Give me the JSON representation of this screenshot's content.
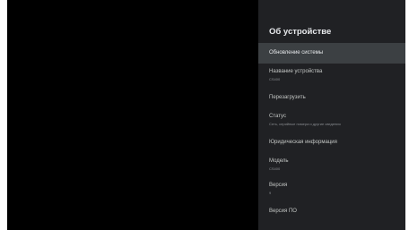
{
  "settings_panel": {
    "title": "Об устройстве",
    "items": [
      {
        "label": "Обновление системы",
        "subtitle": ""
      },
      {
        "label": "Название устройства",
        "subtitle": "CS400"
      },
      {
        "label": "Перезагрузить",
        "subtitle": ""
      },
      {
        "label": "Статус",
        "subtitle": "Сеть, серийные номера и другие сведения"
      },
      {
        "label": "Юридическая информация",
        "subtitle": ""
      },
      {
        "label": "Модель",
        "subtitle": "CS400"
      },
      {
        "label": "Версия",
        "subtitle": "9"
      },
      {
        "label": "Версия ПО",
        "subtitle": ""
      }
    ]
  },
  "colors": {
    "screen_background": "#000000",
    "panel_background": "#202124",
    "selected_item_background": "#3c4043",
    "primary_text": "#e8eaed",
    "secondary_text": "#8a8d91"
  }
}
